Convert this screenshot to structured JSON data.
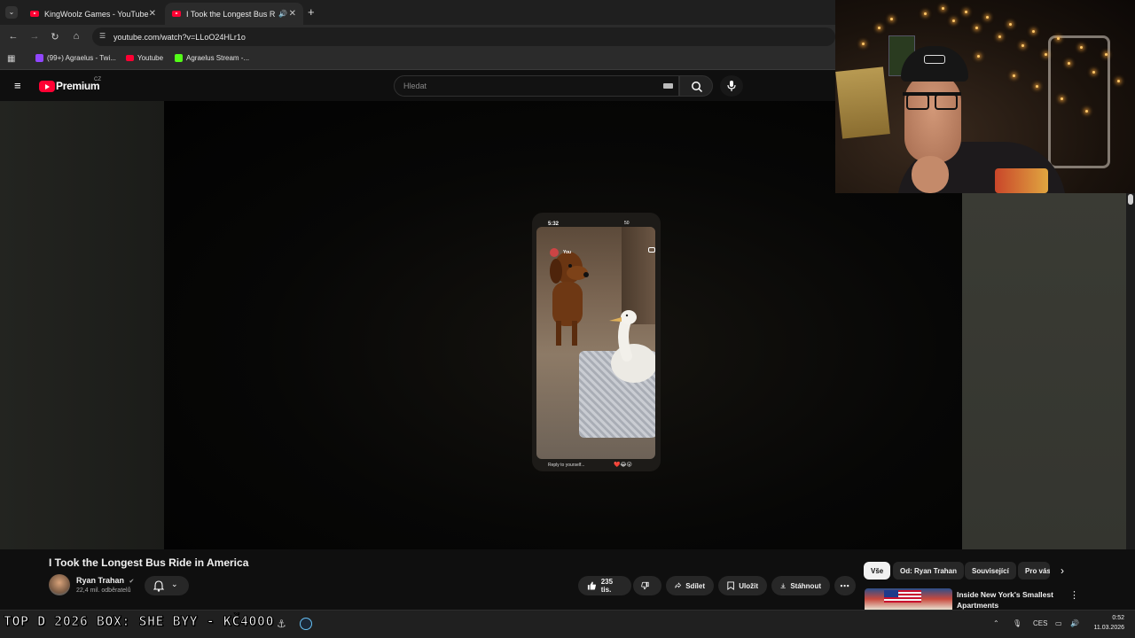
{
  "browser": {
    "tabs": [
      {
        "label": "KingWoolz Games - YouTube",
        "active": false
      },
      {
        "label": "I Took the Longest Bus Ride",
        "active": true
      }
    ],
    "url": "youtube.com/watch?v=LLoO24HLr1o",
    "bookmarks": [
      {
        "label": "(99+) Agraelus - Twi...",
        "icon": "twitch-icon",
        "color": "#9146ff"
      },
      {
        "label": "Youtube",
        "icon": "youtube-icon",
        "color": "#ff0033"
      },
      {
        "label": "Agraelus Stream -...",
        "icon": "kick-icon",
        "color": "#53fc18"
      }
    ]
  },
  "youtube": {
    "brand": "Premium",
    "region": "CZ",
    "search_placeholder": "Hledat",
    "video": {
      "title": "I Took the Longest Bus Ride in America",
      "phone_time": "5:32",
      "phone_battery": "50",
      "phone_user": "You",
      "phone_reply": "Reply to yourself..."
    },
    "channel": {
      "name": "Ryan Trahan",
      "subscribers": "22,4 mil. odběratelů"
    },
    "actions": {
      "likes": "235 tis.",
      "share": "Sdílet",
      "save": "Uložit",
      "download": "Stáhnout"
    },
    "chips": [
      "Vše",
      "Od: Ryan Trahan",
      "Související",
      "Pro vás"
    ],
    "recommended": {
      "title": "Inside New York's Smallest Apartments"
    }
  },
  "taskbar": {
    "banner": "TOP D 2026 BOX: SHE  BYY - KČ4000",
    "language": "CES",
    "time": "0:52",
    "date": "11.03.2026"
  }
}
